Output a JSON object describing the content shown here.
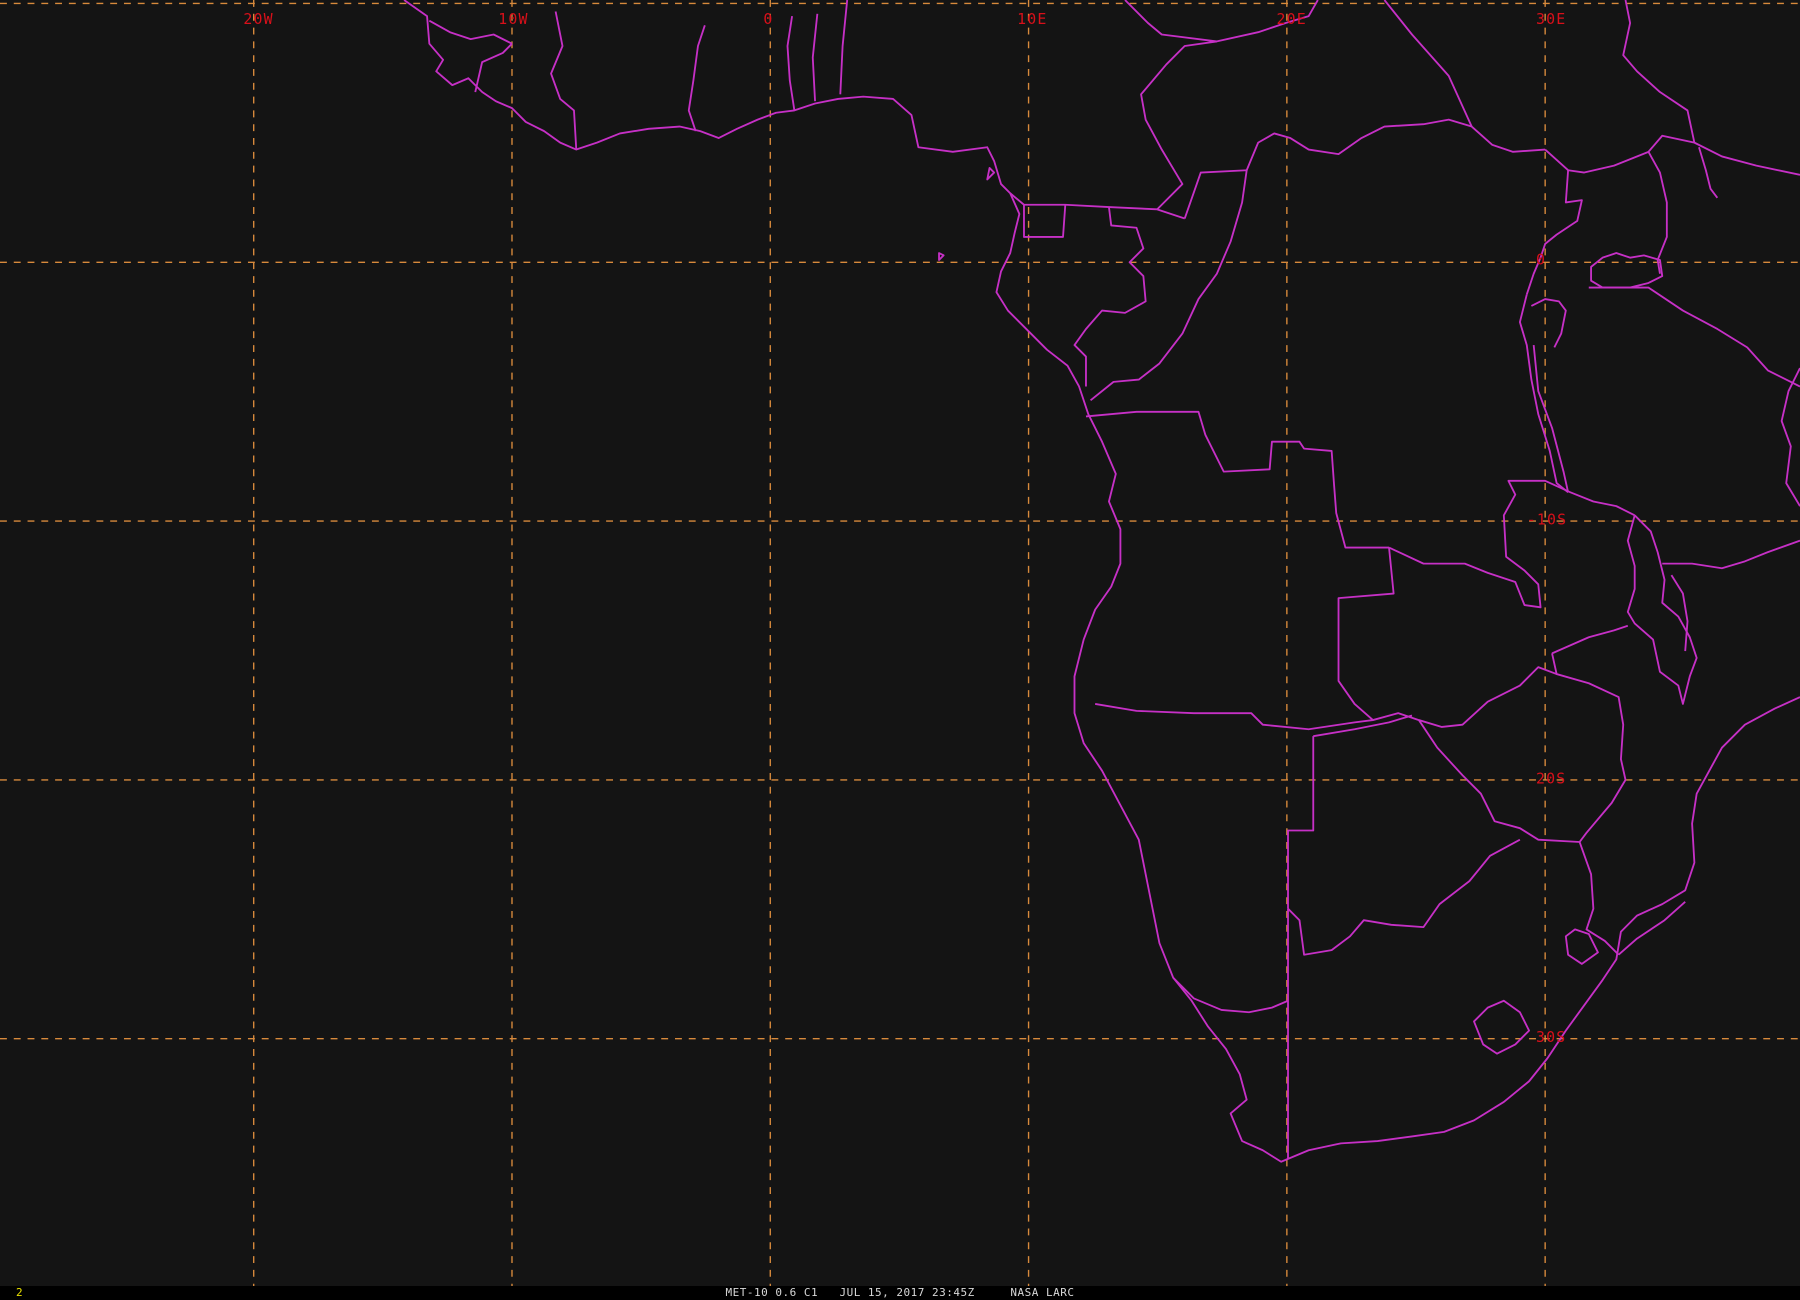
{
  "map": {
    "grid": {
      "lon_labels": [
        "20W",
        "10W",
        "0",
        "10E",
        "20E",
        "30E"
      ],
      "lat_labels": [
        "0",
        "-10S",
        "20S",
        "30S"
      ]
    },
    "colors": {
      "background": "#141414",
      "grid": "#d88a3c",
      "grid_labels": "#d8101a",
      "borders": "#c630c6"
    }
  },
  "status_bar": {
    "frame_number": "2",
    "caption": "MET-10 0.6 C1   JUL 15, 2017 23:45Z     NASA LARC"
  }
}
